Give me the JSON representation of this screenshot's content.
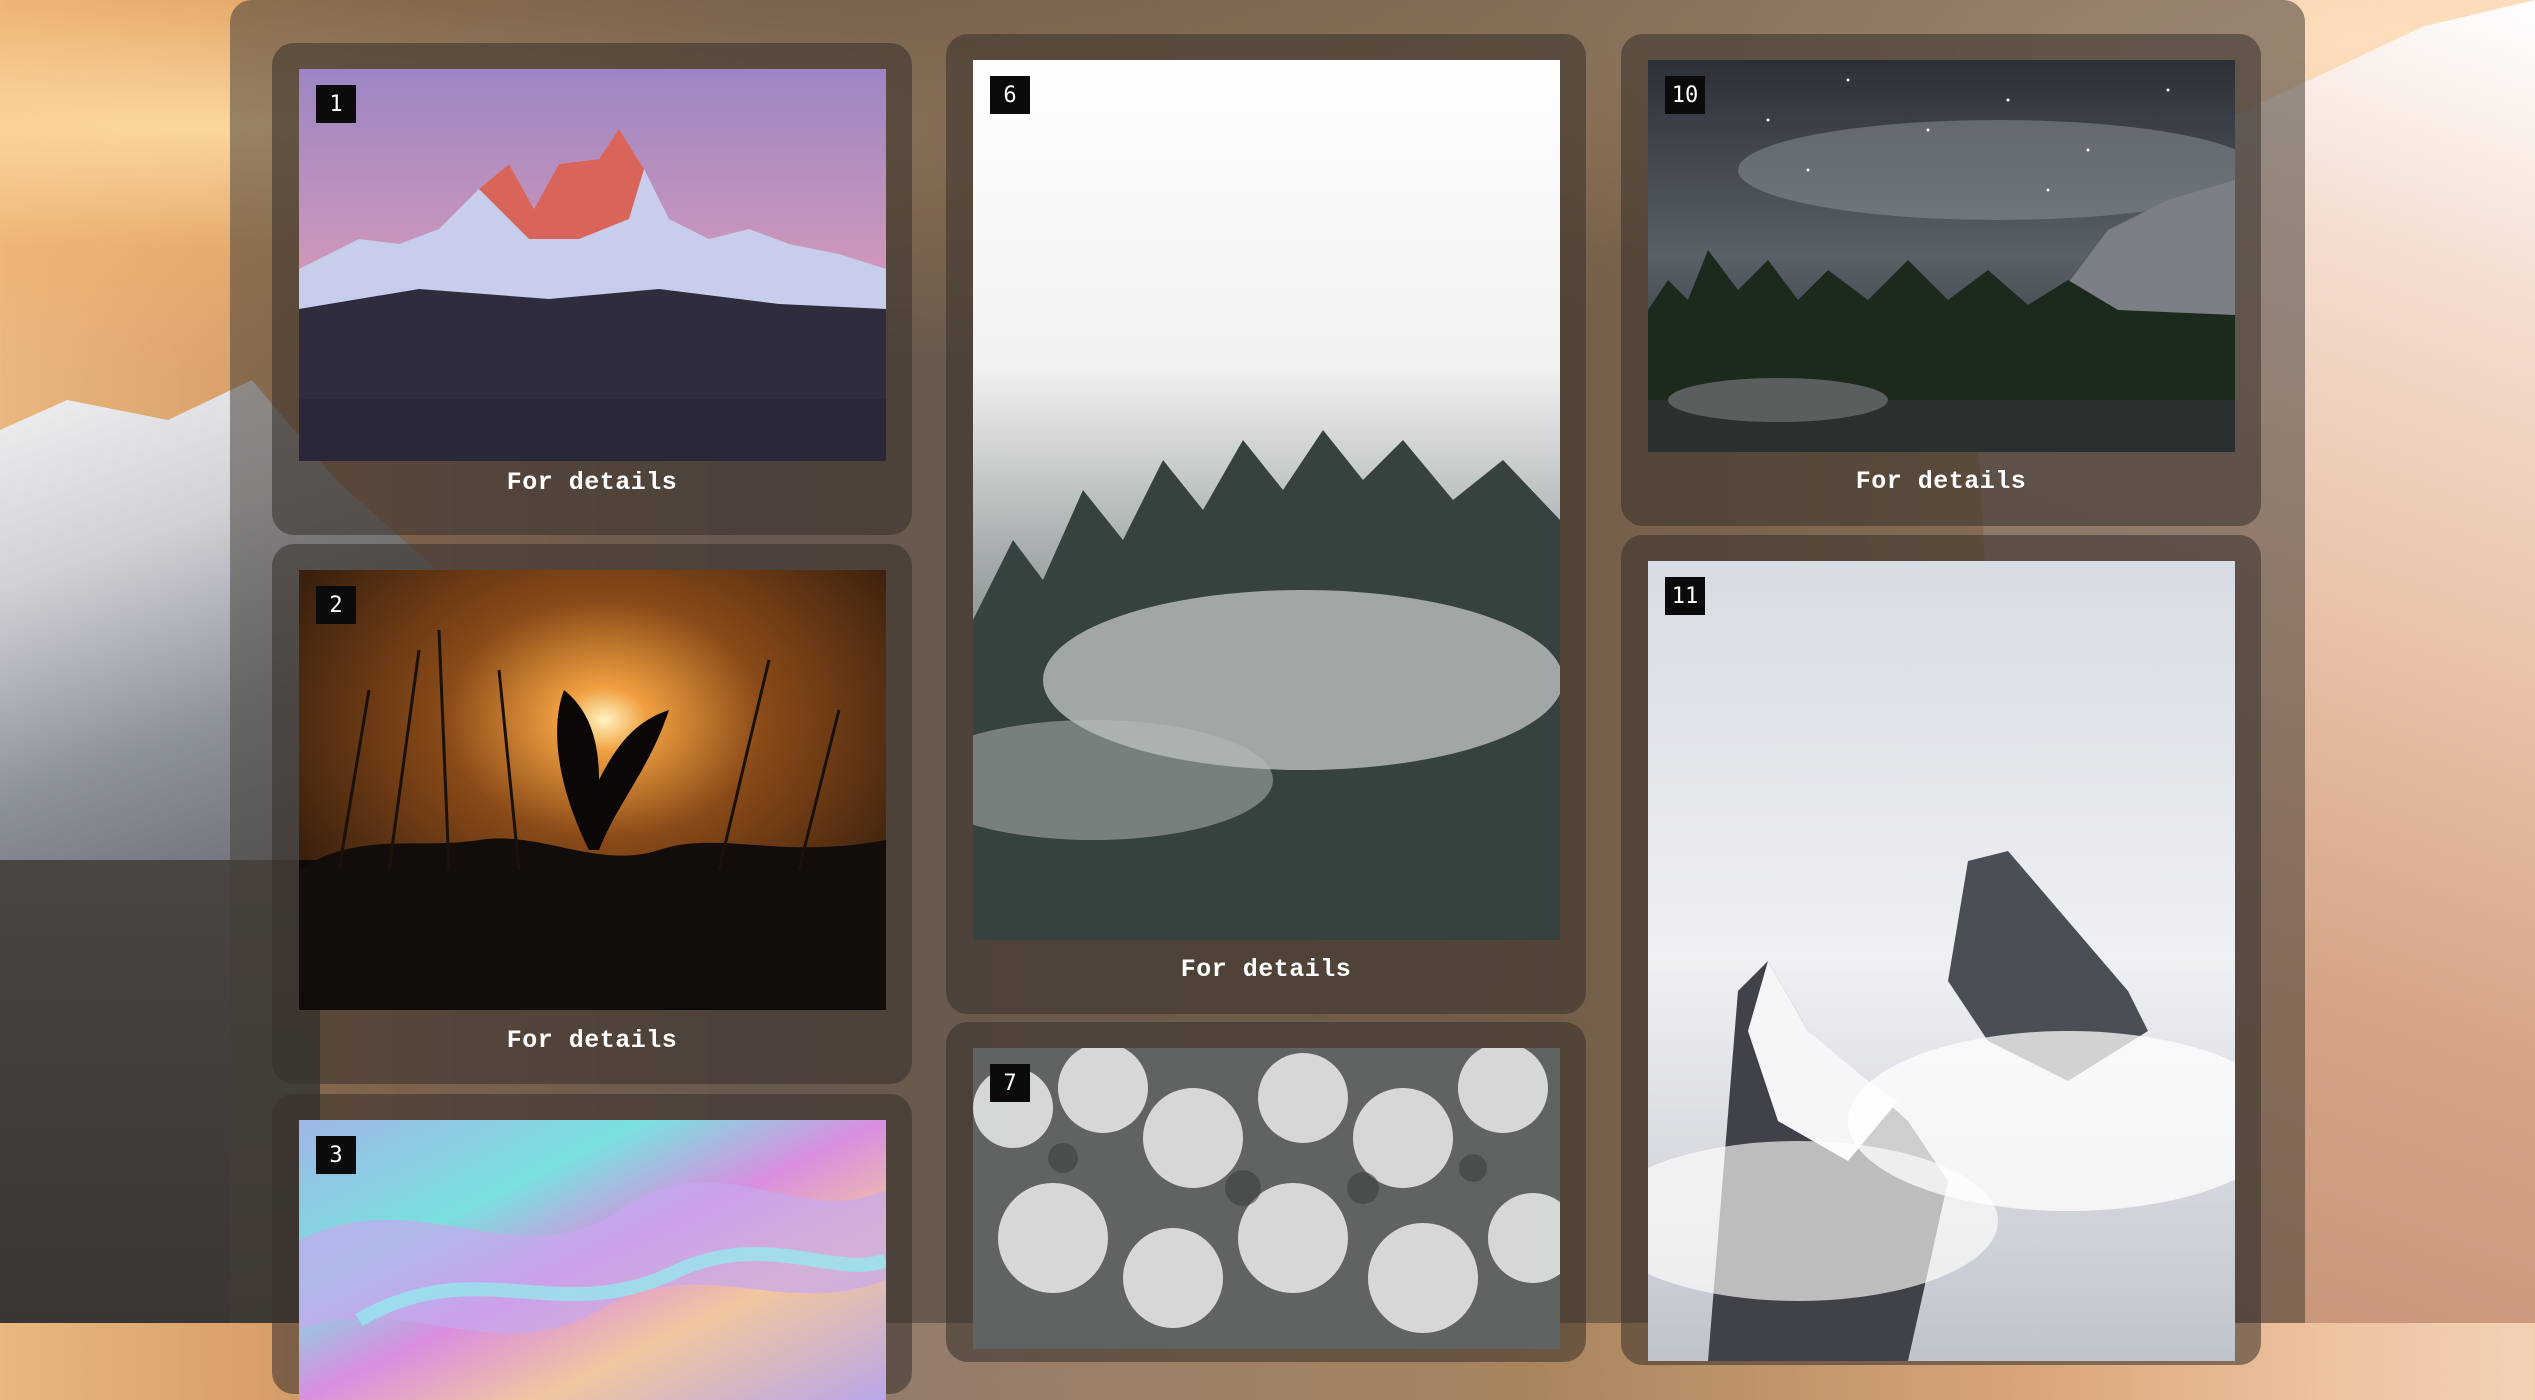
{
  "gallery": {
    "cards": [
      {
        "number": "1",
        "link_label": "For details",
        "scene": "pink mountain peaks at dusk"
      },
      {
        "number": "2",
        "link_label": "For details",
        "scene": "sunset silhouette of grass"
      },
      {
        "number": "3",
        "link_label": "",
        "scene": "holographic iridescent abstract"
      },
      {
        "number": "6",
        "link_label": "For details",
        "scene": "misty pine forest"
      },
      {
        "number": "7",
        "link_label": "",
        "scene": "snowy forest from above"
      },
      {
        "number": "10",
        "link_label": "For details",
        "scene": "milky way over lake and forest"
      },
      {
        "number": "11",
        "link_label": "",
        "scene": "snowy peak in clouds"
      }
    ]
  },
  "colors": {
    "panel_overlay": "#463e37",
    "badge_bg": "#0b0b0b",
    "text": "#ffffff"
  }
}
